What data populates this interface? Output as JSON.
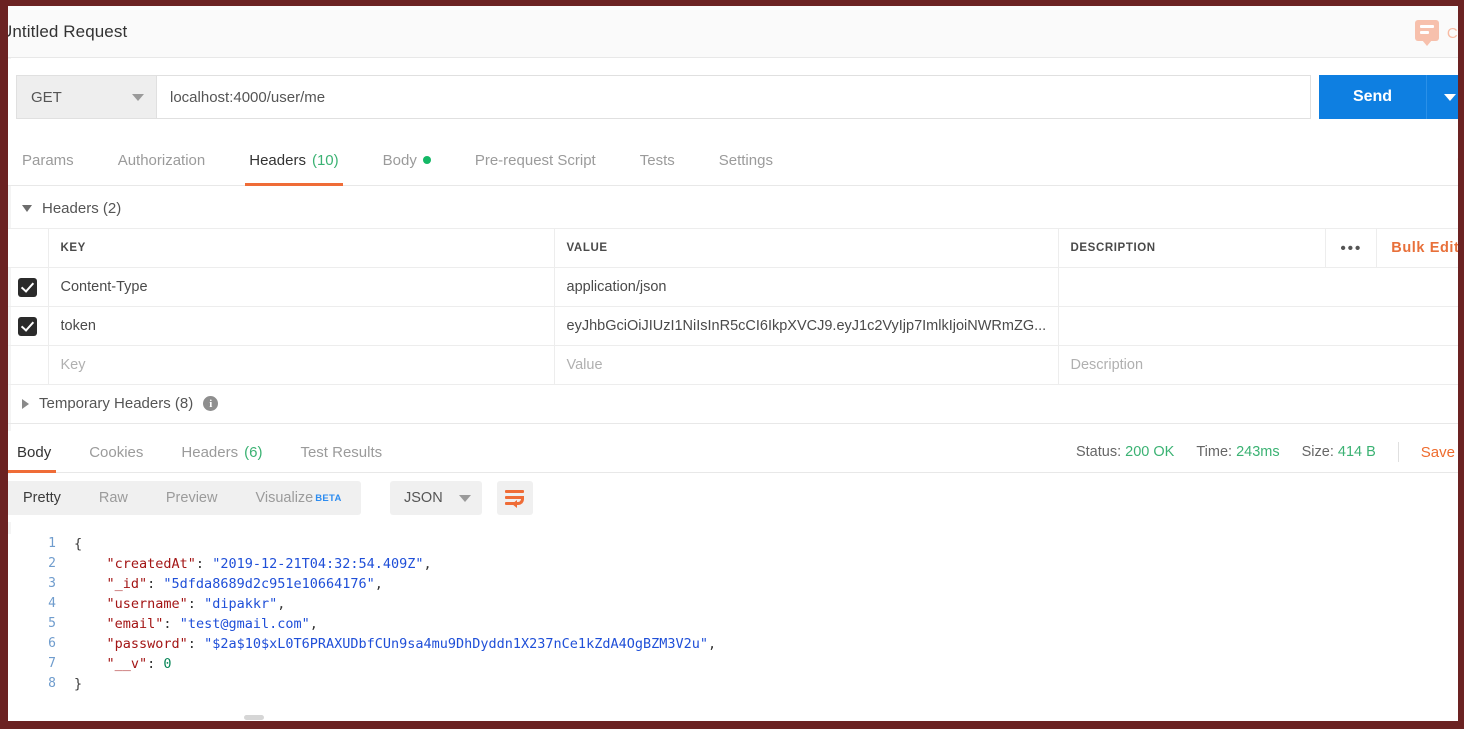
{
  "window": {
    "request_title": "Untitled Request",
    "comment_label": "Co",
    "comment_icon": "comment-bubble-icon"
  },
  "url_bar": {
    "method": "GET",
    "method_caret_icon": "chevron-down-icon",
    "url": "localhost:4000/user/me",
    "send_label": "Send",
    "send_caret_icon": "chevron-down-icon"
  },
  "request_tabs": {
    "items": [
      {
        "label": "Params",
        "count": "",
        "active": false
      },
      {
        "label": "Authorization",
        "count": "",
        "active": false
      },
      {
        "label": "Headers",
        "count": "(10)",
        "active": true
      },
      {
        "label": "Body",
        "count": "",
        "active": false,
        "dot": true
      },
      {
        "label": "Pre-request Script",
        "count": "",
        "active": false
      },
      {
        "label": "Tests",
        "count": "",
        "active": false
      },
      {
        "label": "Settings",
        "count": "",
        "active": false
      }
    ],
    "code_link": "C"
  },
  "headers_section": {
    "title": "Headers (2)",
    "collapse_icon": "triangle-down-icon",
    "columns": [
      "KEY",
      "VALUE",
      "DESCRIPTION"
    ],
    "more_icon": "ellipsis-icon",
    "bulk_edit": "Bulk Edit",
    "rows": [
      {
        "checked": true,
        "key": "Content-Type",
        "value": "application/json",
        "description": ""
      },
      {
        "checked": true,
        "key": "token",
        "value": "eyJhbGciOiJIUzI1NiIsInR5cCI6IkpXVCJ9.eyJ1c2VyIjp7ImlkIjoiNWRmZG...",
        "description": ""
      }
    ],
    "placeholder_row": {
      "key": "Key",
      "value": "Value",
      "description": "Description"
    },
    "temporary_headers": {
      "title": "Temporary Headers (8)",
      "expand_icon": "triangle-right-icon",
      "info_icon": "info-icon",
      "info_char": "i"
    }
  },
  "response": {
    "tabs": [
      {
        "label": "Body",
        "count": "",
        "active": true
      },
      {
        "label": "Cookies",
        "count": "",
        "active": false
      },
      {
        "label": "Headers",
        "count": "(6)",
        "active": false
      },
      {
        "label": "Test Results",
        "count": "",
        "active": false
      }
    ],
    "meta": {
      "status_label": "Status:",
      "status_value": "200 OK",
      "time_label": "Time:",
      "time_value": "243ms",
      "size_label": "Size:",
      "size_value": "414 B",
      "save_response": "Save R"
    },
    "format_tabs": [
      {
        "label": "Pretty",
        "active": true
      },
      {
        "label": "Raw",
        "active": false
      },
      {
        "label": "Preview",
        "active": false
      },
      {
        "label": "Visualize",
        "active": false,
        "badge": "BETA"
      }
    ],
    "language": "JSON",
    "language_caret_icon": "chevron-down-icon",
    "wrap_icon": "wrap-lines-icon",
    "line_numbers": [
      "1",
      "2",
      "3",
      "4",
      "5",
      "6",
      "7",
      "8"
    ],
    "body_lines": [
      {
        "indent": 0,
        "type": "brace",
        "text": "{"
      },
      {
        "indent": 1,
        "type": "pair",
        "key": "\"createdAt\"",
        "value": "\"2019-12-21T04:32:54.409Z\"",
        "value_type": "string",
        "comma": true
      },
      {
        "indent": 1,
        "type": "pair",
        "key": "\"_id\"",
        "value": "\"5dfda8689d2c951e10664176\"",
        "value_type": "string",
        "comma": true
      },
      {
        "indent": 1,
        "type": "pair",
        "key": "\"username\"",
        "value": "\"dipakkr\"",
        "value_type": "string",
        "comma": true
      },
      {
        "indent": 1,
        "type": "pair",
        "key": "\"email\"",
        "value": "\"test@gmail.com\"",
        "value_type": "string",
        "comma": true
      },
      {
        "indent": 1,
        "type": "pair",
        "key": "\"password\"",
        "value": "\"$2a$10$xL0T6PRAXUDbfCUn9sa4mu9DhDyddn1X237nCe1kZdA4OgBZM3V2u\"",
        "value_type": "string",
        "comma": true
      },
      {
        "indent": 1,
        "type": "pair",
        "key": "\"__v\"",
        "value": "0",
        "value_type": "number",
        "comma": false
      },
      {
        "indent": 0,
        "type": "brace",
        "text": "}"
      }
    ]
  },
  "colors": {
    "accent_orange": "#ef6c37",
    "send_blue": "#0e7fe1",
    "success_green": "#3bb273",
    "frame": "#6b2222"
  }
}
